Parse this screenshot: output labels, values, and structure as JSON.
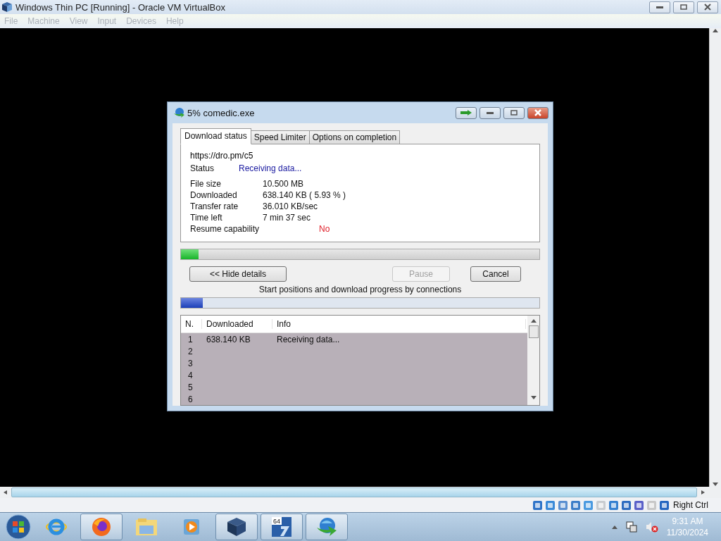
{
  "window": {
    "title": "Windows Thin PC [Running] - Oracle VM VirtualBox"
  },
  "menu": [
    "File",
    "Machine",
    "View",
    "Input",
    "Devices",
    "Help"
  ],
  "dialog": {
    "title": "5% comedic.exe",
    "tabs": [
      {
        "label": "Download status",
        "selected": true
      },
      {
        "label": "Speed Limiter",
        "selected": false
      },
      {
        "label": "Options on completion",
        "selected": false
      }
    ],
    "url": "https://dro.pm/c5",
    "status": {
      "label": "Status",
      "value": "Receiving data..."
    },
    "fields": [
      {
        "label": "File size",
        "value": "10.500  MB",
        "kind": "normal"
      },
      {
        "label": "Downloaded",
        "value": "638.140  KB  ( 5.93 % )",
        "kind": "normal"
      },
      {
        "label": "Transfer rate",
        "value": "36.010  KB/sec",
        "kind": "normal"
      },
      {
        "label": "Time left",
        "value": "7 min 37 sec",
        "kind": "normal"
      },
      {
        "label": "Resume capability",
        "value": "No",
        "kind": "warning"
      }
    ],
    "progress": {
      "level": 0.05
    },
    "buttons": [
      {
        "label": "<< Hide details",
        "disabled": false
      },
      {
        "label": "Pause",
        "disabled": true
      },
      {
        "label": "Cancel",
        "disabled": false
      }
    ],
    "connections_caption": "Start positions and download progress by connections",
    "connections_bar": {
      "level": 0.06
    },
    "table": {
      "columns": [
        "N.",
        "Downloaded",
        "Info"
      ],
      "rows": [
        [
          "1",
          "638.140  KB",
          "Receiving data..."
        ],
        [
          "2",
          "",
          ""
        ],
        [
          "3",
          "",
          ""
        ],
        [
          "4",
          "",
          ""
        ],
        [
          "5",
          "",
          ""
        ],
        [
          "6",
          "",
          ""
        ]
      ]
    }
  },
  "status_bar": {
    "host_key": "Right Ctrl"
  },
  "taskbar": {
    "items": [
      {
        "kind": "ie",
        "open": false
      },
      {
        "kind": "firefox",
        "open": true
      },
      {
        "kind": "explorer",
        "open": false
      },
      {
        "kind": "media",
        "open": false
      },
      {
        "kind": "virtualbox",
        "open": true
      },
      {
        "kind": "seven",
        "open": true,
        "badge": "64"
      },
      {
        "kind": "idm",
        "open": true
      }
    ],
    "time": "9:31 AM",
    "date": "11/30/2024"
  }
}
